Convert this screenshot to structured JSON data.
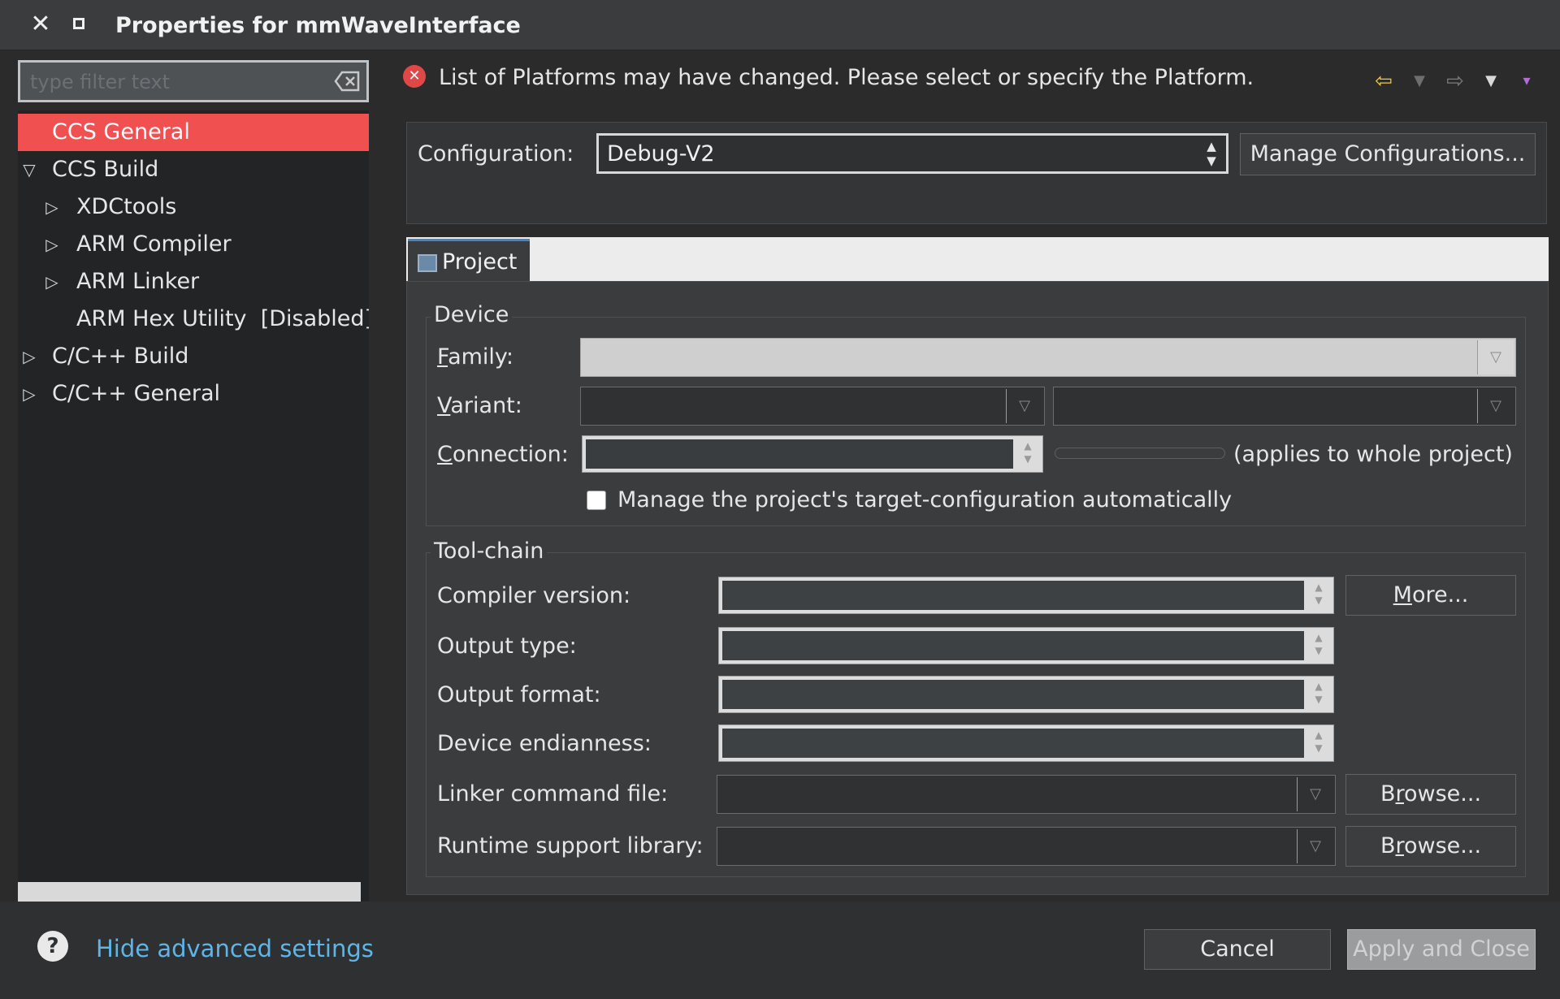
{
  "window": {
    "title": "Properties for mmWaveInterface",
    "close_glyph": "✕"
  },
  "sidebar": {
    "filter_placeholder": "type filter text",
    "items": [
      {
        "label": "CCS General",
        "expanded": null,
        "selected": true
      },
      {
        "label": "CCS Build",
        "expanded": true
      },
      {
        "label": "XDCtools",
        "expanded": false
      },
      {
        "label": "ARM Compiler",
        "expanded": false
      },
      {
        "label": "ARM Linker",
        "expanded": false
      },
      {
        "label": "ARM Hex Utility  [Disabled]",
        "expanded": null
      },
      {
        "label": "C/C++ Build",
        "expanded": false
      },
      {
        "label": "C/C++ General",
        "expanded": false
      }
    ]
  },
  "message": {
    "text": "List of Platforms may have changed. Please select or specify the Platform.",
    "icon": "error-icon"
  },
  "config": {
    "label": "Configuration:",
    "value": "Debug-V2",
    "manage_button": "Manage Configurations..."
  },
  "tabs": [
    {
      "label": "Project",
      "active": true
    }
  ],
  "device": {
    "group_title": "Device",
    "family_label": "Family:",
    "variant_label": "Variant:",
    "connection_label": "Connection:",
    "connection_note": "(applies to whole project)",
    "manage_target_label": "Manage the project's target-configuration automatically",
    "manage_target_checked": false
  },
  "toolchain": {
    "group_title": "Tool-chain",
    "compiler_version_label": "Compiler version:",
    "output_type_label": "Output type:",
    "output_format_label": "Output format:",
    "device_endianness_label": "Device endianness:",
    "linker_cmd_label": "Linker command file:",
    "runtime_lib_label": "Runtime support library:",
    "more_button": "More...",
    "browse_button": "Browse..."
  },
  "footer": {
    "hide_advanced": "Hide advanced settings",
    "cancel": "Cancel",
    "apply_close": "Apply and Close"
  },
  "colors": {
    "selection": "#f05050",
    "link": "#5fb6e6",
    "error": "#e04848",
    "back_arrow": "#f5c542"
  }
}
